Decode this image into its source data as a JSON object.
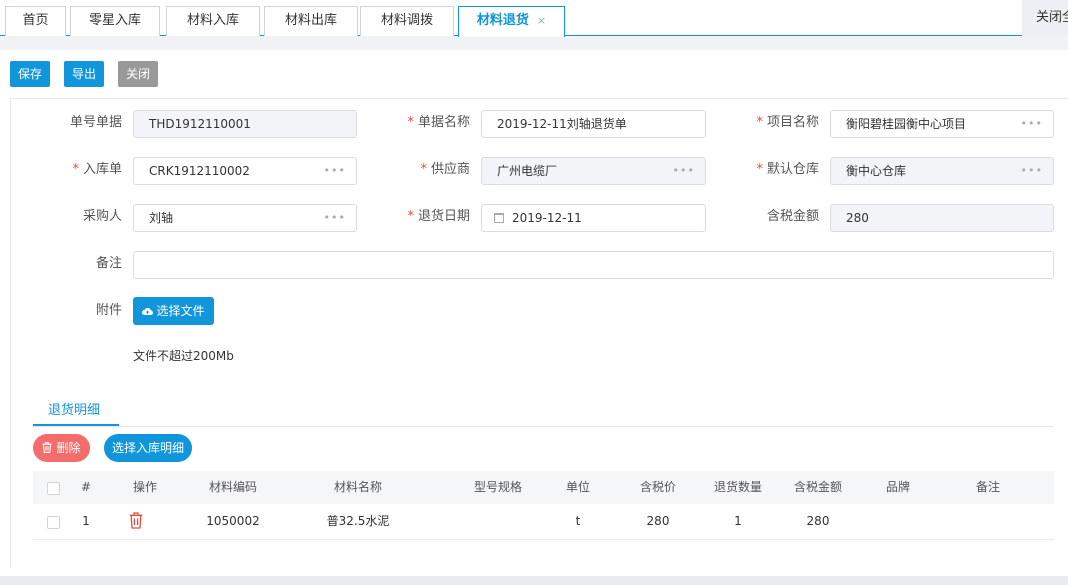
{
  "tabs": [
    {
      "label": "首页"
    },
    {
      "label": "零星入库"
    },
    {
      "label": "材料入库"
    },
    {
      "label": "材料出库"
    },
    {
      "label": "材料调拨"
    },
    {
      "label": "材料退货",
      "active": true,
      "close": "×"
    }
  ],
  "close_all": "关闭全部",
  "toolbar": {
    "save": "保存",
    "export": "导出",
    "close": "关闭"
  },
  "form": {
    "doc_no": {
      "label": "单号单据",
      "value": "THD1912110001"
    },
    "doc_name": {
      "label": "单据名称",
      "value": "2019-12-11刘轴退货单",
      "required": true
    },
    "project": {
      "label": "项目名称",
      "value": "衡阳碧桂园衡中心项目",
      "required": true
    },
    "inbound": {
      "label": "入库单",
      "value": "CRK1912110002",
      "required": true
    },
    "supplier": {
      "label": "供应商",
      "value": "广州电缆厂",
      "required": true
    },
    "warehouse": {
      "label": "默认仓库",
      "value": "衡中心仓库",
      "required": true
    },
    "buyer": {
      "label": "采购人",
      "value": "刘轴"
    },
    "return_date": {
      "label": "退货日期",
      "value": "2019-12-11",
      "required": true
    },
    "tax_amount": {
      "label": "含税金额",
      "value": "280"
    },
    "remark": {
      "label": "备注",
      "value": ""
    },
    "attachment": {
      "label": "附件",
      "button": "选择文件",
      "hint": "文件不超过200Mb"
    },
    "ellipsis": "•••",
    "required_mark": "*"
  },
  "detail": {
    "tab_label": "退货明细",
    "delete_button": "删除",
    "select_button": "选择入库明细",
    "columns": [
      "#",
      "操作",
      "材料编码",
      "材料名称",
      "型号规格",
      "单位",
      "含税价",
      "退货数量",
      "含税金额",
      "品牌",
      "备注"
    ],
    "rows": [
      {
        "index": "1",
        "code": "1050002",
        "name": "普32.5水泥",
        "spec": "",
        "unit": "t",
        "price": "280",
        "qty": "1",
        "amount": "280",
        "brand": "",
        "remark": ""
      }
    ]
  },
  "colors": {
    "accent": "#1296db",
    "danger": "#f56c6c",
    "required": "#e74c3c"
  },
  "icons": [
    "close-icon",
    "ellipsis-icon",
    "calendar-icon",
    "cloud-upload-icon",
    "trash-icon"
  ]
}
